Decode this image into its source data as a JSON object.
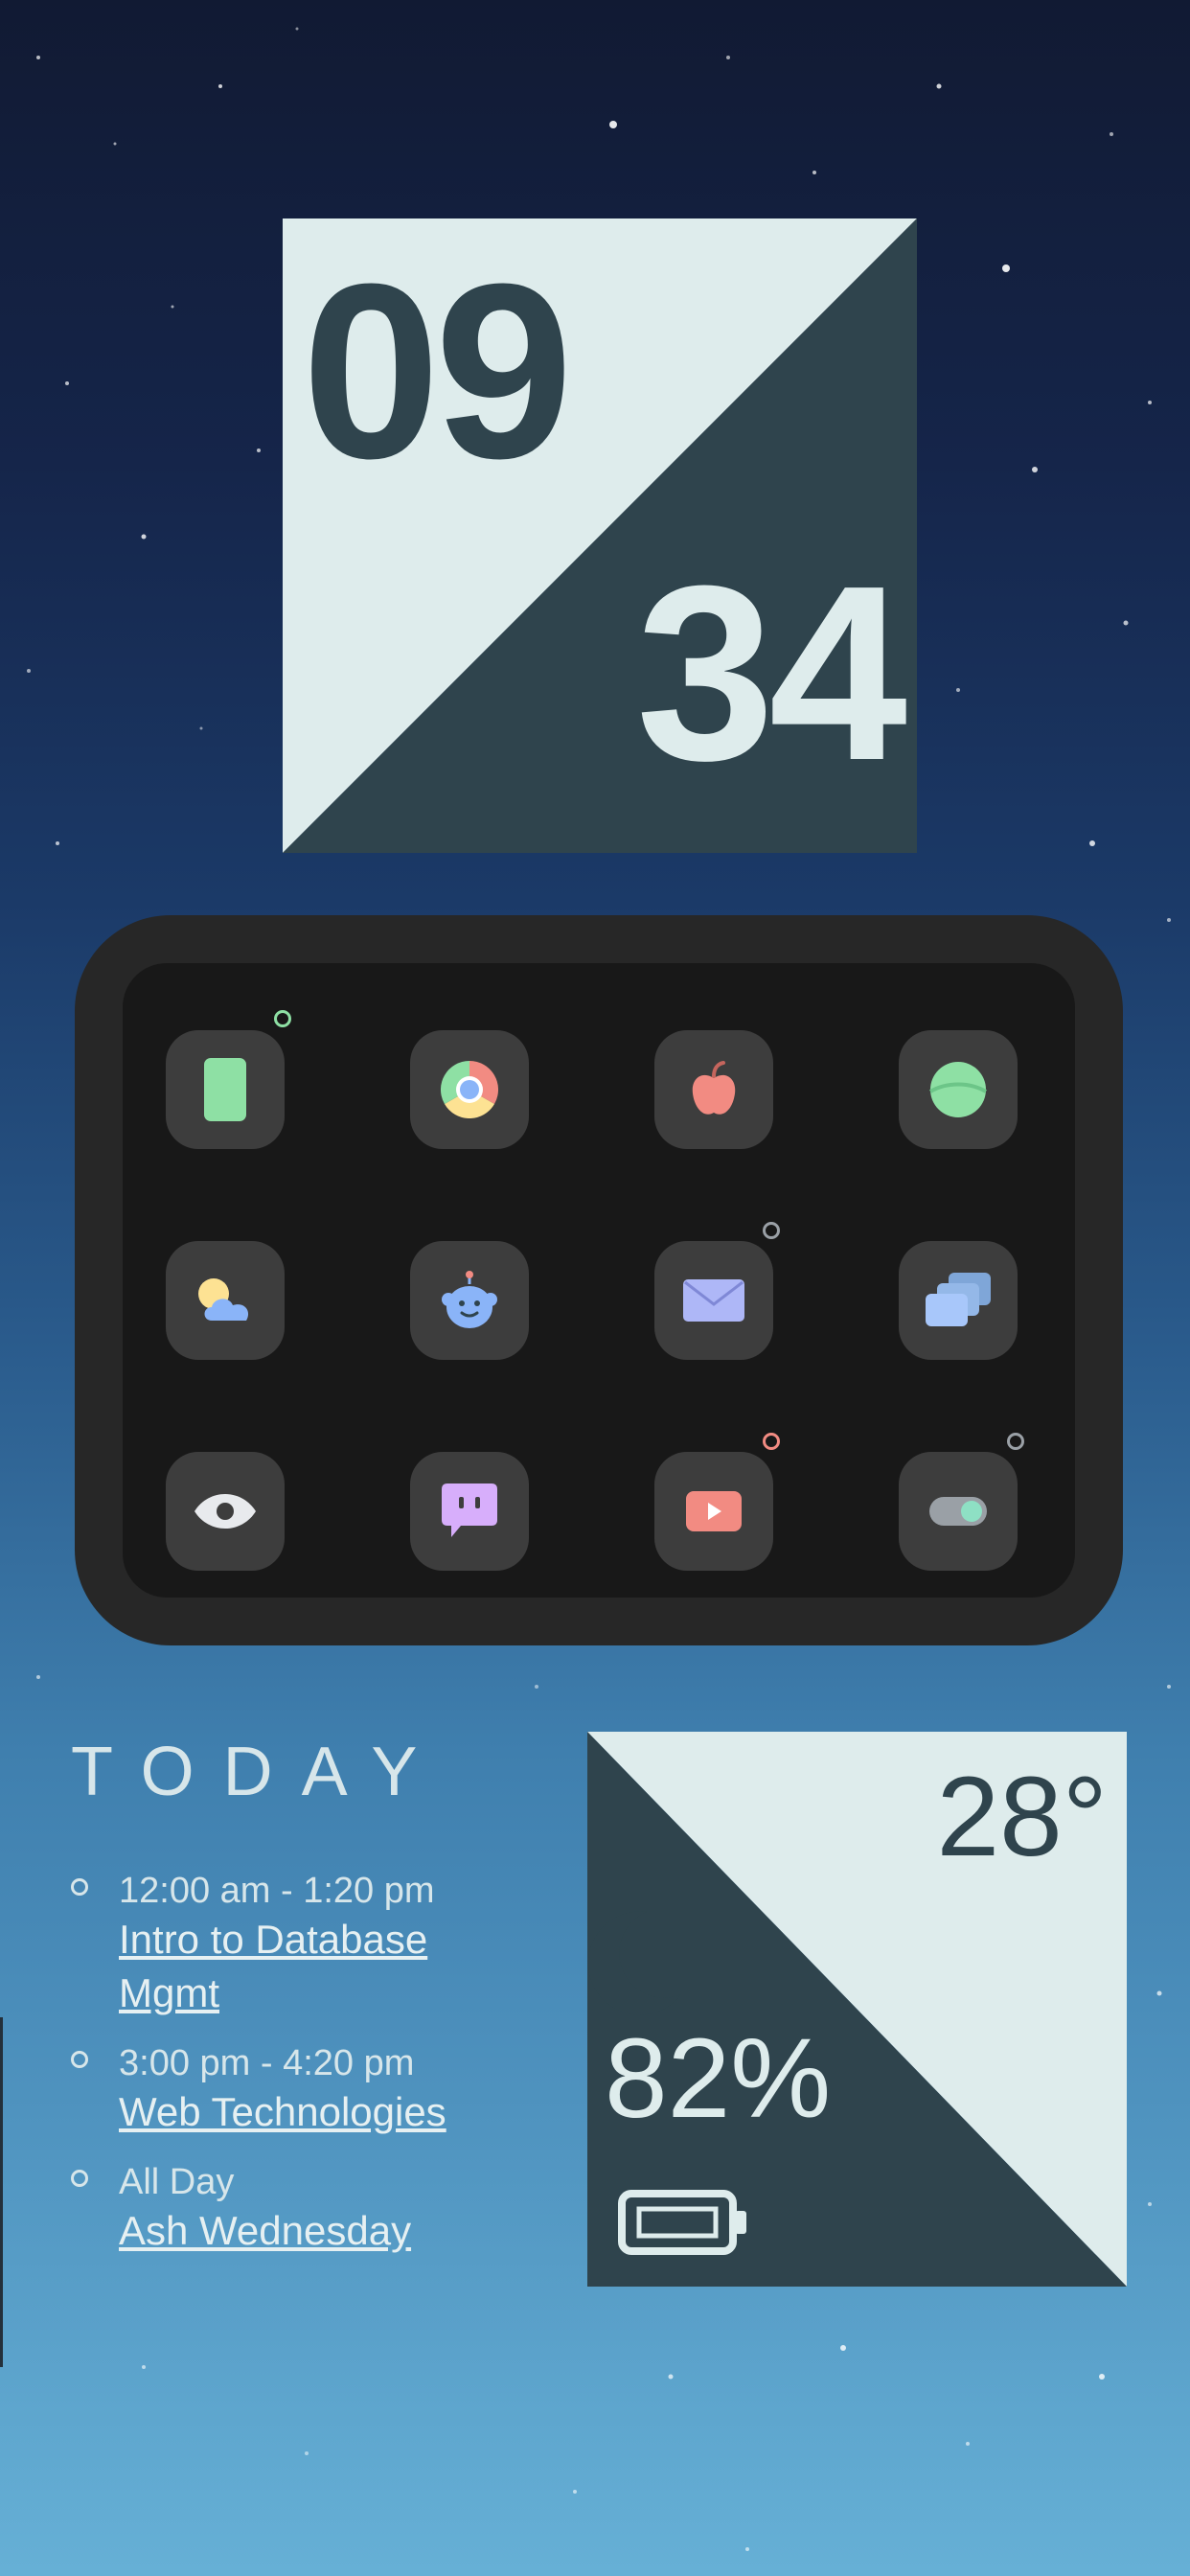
{
  "clock": {
    "hours": "09",
    "minutes": "34"
  },
  "dock": {
    "apps": [
      {
        "icon": "phone-icon",
        "color": "#8ee0a4",
        "badge": "#8ee0a4"
      },
      {
        "icon": "chrome-icon",
        "color": "#f28b82"
      },
      {
        "icon": "apple-icon",
        "color": "#f28b82"
      },
      {
        "icon": "circle-app-icon",
        "color": "#8ee0a4"
      },
      {
        "icon": "weather-icon",
        "color": "#fde293"
      },
      {
        "icon": "robot-icon",
        "color": "#8ab4f8"
      },
      {
        "icon": "mail-icon",
        "color": "#aeb7f7",
        "badge": "#9aa0a6"
      },
      {
        "icon": "windows-icon",
        "color": "#a8c7fa"
      },
      {
        "icon": "eye-icon",
        "color": "#e8eaed"
      },
      {
        "icon": "chat-icon",
        "color": "#d7aefb"
      },
      {
        "icon": "video-icon",
        "color": "#f28b82",
        "badge": "#f28b82"
      },
      {
        "icon": "toggle-icon",
        "color": "#8ee0c4",
        "badge": "#9aa0a6"
      }
    ]
  },
  "agenda": {
    "title": "TODAY",
    "events": [
      {
        "time": "12:00 am - 1:20 pm",
        "title": "Intro to Database Mgmt"
      },
      {
        "time": "3:00 pm - 4:20 pm",
        "title": "Web Technologies"
      },
      {
        "time": "All Day",
        "title": "Ash Wednesday"
      }
    ]
  },
  "weather": {
    "temperature": "28°",
    "condition_icon": "moon-icon",
    "battery": "82%",
    "battery_icon": "battery-icon"
  },
  "colors": {
    "light": "#deecec",
    "dark": "#2f444d"
  }
}
